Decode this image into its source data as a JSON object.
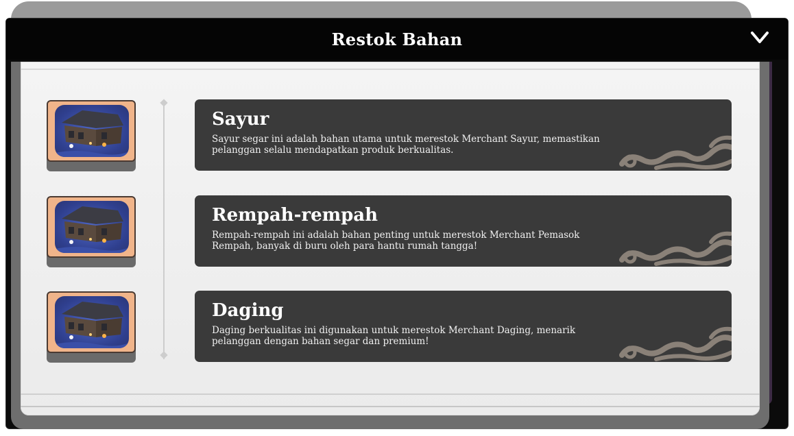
{
  "window": {
    "title": "Restok Bahan",
    "collapse_icon": "chevron-down-icon"
  },
  "items": [
    {
      "name": "Sayur",
      "description": "Sayur segar ini adalah bahan utama untuk merestok Merchant Sayur, memastikan pelanggan selalu mendapatkan produk berkualitas."
    },
    {
      "name": "Rempah-rempah",
      "description": "Rempah-rempah ini adalah bahan penting untuk merestok Merchant Pemasok Rempah, banyak di buru oleh para hantu rumah tangga!"
    },
    {
      "name": "Daging",
      "description": "Daging berkualitas ini digunakan untuk merestok Merchant Daging, menarik pelanggan dengan bahan segar dan premium!"
    }
  ],
  "colors": {
    "header_bg": "#050505",
    "card_bg": "#3a3a3a",
    "thumb_frame": "#f0b48a",
    "swirl": "#8a8178",
    "accent_purple": "#3d2b45"
  }
}
